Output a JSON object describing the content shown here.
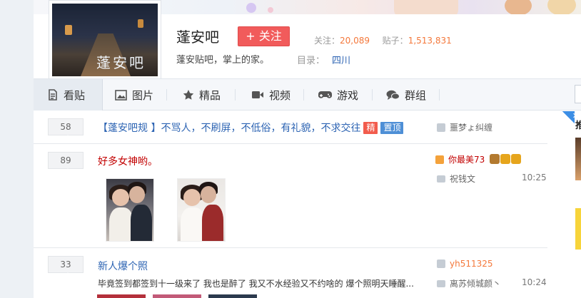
{
  "forum": {
    "name": "蓬安吧",
    "avatar_text": "蓬安吧",
    "follow_label": "+ 关注",
    "stats": {
      "follow_label": "关注：",
      "follow_count": "20,089",
      "post_label": "贴子：",
      "post_count": "1,513,831"
    },
    "slogan": "蓬安贴吧，掌上的家。",
    "catalog_label": "目录：",
    "catalog_value": "四川"
  },
  "nav": {
    "tabs": [
      {
        "label": "看贴",
        "icon": "doc-icon"
      },
      {
        "label": "图片",
        "icon": "image-icon"
      },
      {
        "label": "精品",
        "icon": "star-icon"
      },
      {
        "label": "视频",
        "icon": "video-icon"
      },
      {
        "label": "游戏",
        "icon": "gamepad-icon"
      },
      {
        "label": "群组",
        "icon": "chat-icon"
      }
    ]
  },
  "threads": [
    {
      "reply_count": "58",
      "title": "【蓬安吧规 】不骂人，不刷屏，不低俗，有礼貌，不求交往",
      "tags": [
        "精",
        "置顶"
      ],
      "author": "噩梦ょ纠缠"
    },
    {
      "reply_count": "89",
      "title": "好多女神哟。",
      "author": "你最美73",
      "last_reply": "祝钱文",
      "time": "10:25"
    },
    {
      "reply_count": "33",
      "title": "新人爆个照",
      "abstract": "毕竟签到都签到十一级来了 我也是醉了 我又不水经验又不约啥的 爆个照明天睡醒...",
      "author": "yh511325",
      "last_reply": "离苏倾城颜丶",
      "time": "10:24"
    }
  ],
  "sidebar": {
    "title": "推"
  },
  "colors": {
    "accent": "#2d64b3",
    "follow": "#f15b5b",
    "count": "#f4783b",
    "hot": "#c20000"
  }
}
